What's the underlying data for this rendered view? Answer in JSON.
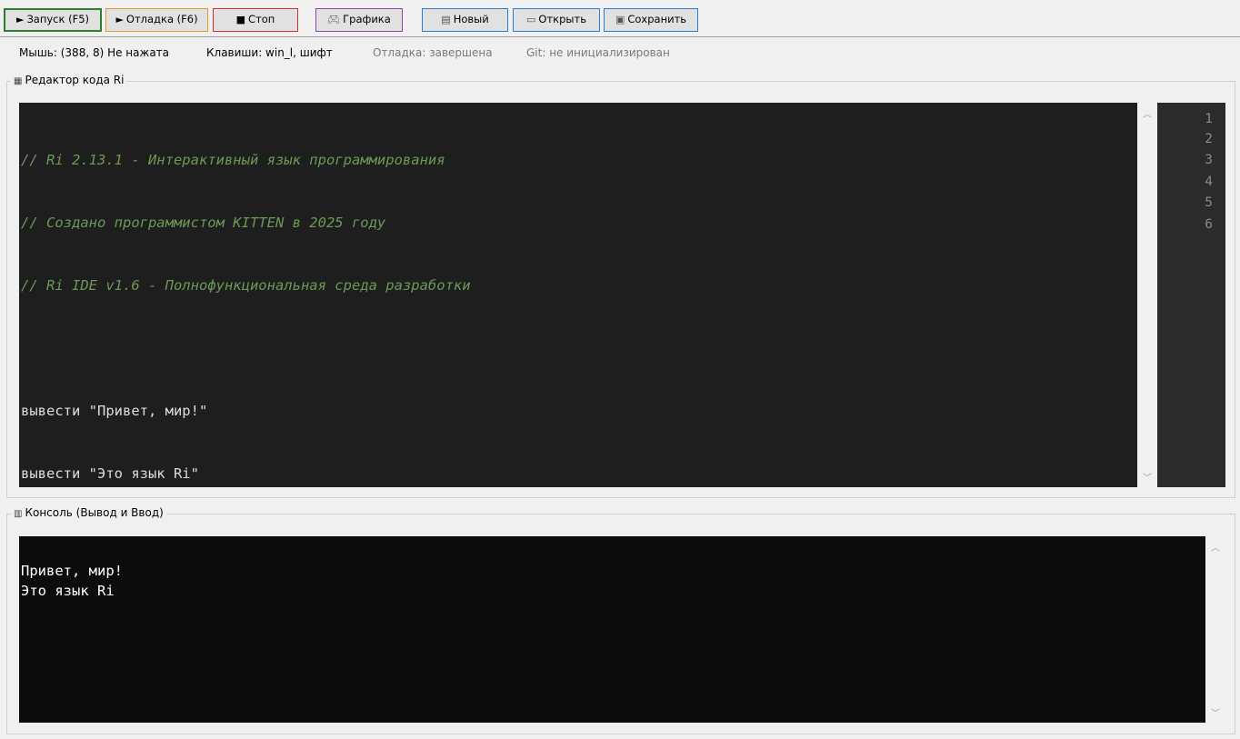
{
  "toolbar": {
    "run_label": "Запуск (F5)",
    "debug_label": "Отладка (F6)",
    "stop_label": "Стоп",
    "graphics_label": "Графика",
    "new_label": "Новый",
    "open_label": "Открыть",
    "save_label": "Сохранить"
  },
  "status": {
    "mouse": "Мышь: (388, 8) Не нажата",
    "keys": "Клавиши: win_l, шифт",
    "debug": "Отладка: завершена",
    "git": "Git: не инициализирован"
  },
  "editor": {
    "title": "Редактор кода Ri",
    "lines": [
      {
        "text": "// Ri 2.13.1 - Интерактивный язык программирования",
        "kind": "comment"
      },
      {
        "text": "// Создано программистом KITTEN в 2025 году",
        "kind": "comment"
      },
      {
        "text": "// Ri IDE v1.6 - Полнофункциональная среда разработки",
        "kind": "comment"
      },
      {
        "text": "",
        "kind": "code"
      },
      {
        "text": "вывести \"Привет, мир!\"",
        "kind": "code"
      },
      {
        "text": "вывести \"Это язык Ri\"",
        "kind": "code"
      }
    ],
    "line_numbers": [
      "1",
      "2",
      "3",
      "4",
      "5",
      "6"
    ]
  },
  "console": {
    "title": "Консоль (Вывод и Ввод)",
    "output": "Привет, мир!\nЭто язык Ri"
  },
  "icons": {
    "run": "play-icon",
    "debug": "play-icon",
    "stop": "stop-square-icon",
    "graphics": "gamepad-icon",
    "new": "new-file-icon",
    "open": "folder-open-icon",
    "save": "save-disk-icon",
    "editor": "edit-document-icon",
    "console": "console-icon"
  },
  "colors": {
    "run_border": "#2e7d32",
    "debug_border": "#e69a2e",
    "stop_border": "#d32f2f",
    "graphics_border": "#8e44ad",
    "file_border": "#2b7fd0",
    "editor_bg": "#1e1e1e",
    "comment": "#6a9955",
    "console_bg": "#0c0c0c"
  }
}
